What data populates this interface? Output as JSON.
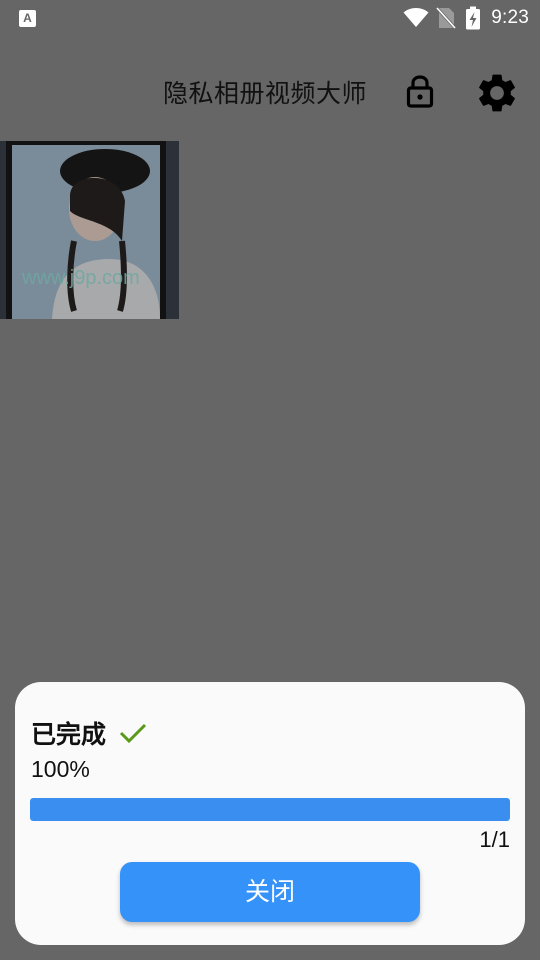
{
  "status_bar": {
    "left_icon": "A",
    "time": "9:23",
    "icons": [
      "wifi-icon",
      "no-sim-icon",
      "battery-charging-icon"
    ]
  },
  "header": {
    "title": "隐私相册视频大师",
    "icons": [
      "lock-icon",
      "gear-icon"
    ]
  },
  "gallery": {
    "items": [
      {
        "thumbnail": "photo-thumbnail",
        "watermark": "www.j9p.com"
      }
    ]
  },
  "dialog": {
    "title": "已完成",
    "status_icon": "check-icon",
    "percent_text": "100%",
    "progress": 1.0,
    "count_text": "1/1",
    "close_label": "关闭"
  },
  "colors": {
    "background": "#666666",
    "accent": "#3592f8",
    "progress_fill": "#3a8ef0",
    "check": "#5a9a1a",
    "dialog_bg": "#fafafa"
  }
}
